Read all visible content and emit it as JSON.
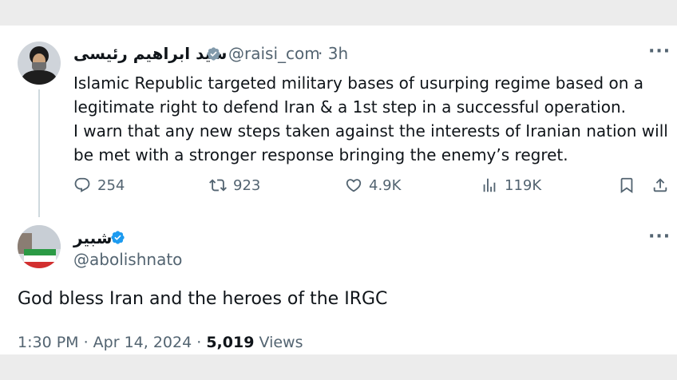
{
  "tweet": {
    "display_name": "سید ابراهیم رئیسی",
    "handle": "@raisi_com",
    "time": "· 3h",
    "more_label": "···",
    "lines": [
      "Islamic Republic targeted military bases of usurping regime based on a",
      "legitimate right to defend Iran & a 1st step in a successful operation.",
      "I warn that any new steps taken against the interests of Iranian nation will",
      "be met with a stronger response bringing the enemy’s regret."
    ],
    "actions": {
      "replies": "254",
      "reposts": "923",
      "likes": "4.9K",
      "views": "119K"
    },
    "icons": [
      "reply-icon",
      "repost-icon",
      "like-icon",
      "views-icon",
      "bookmark-icon",
      "share-icon"
    ]
  },
  "reply": {
    "display_name": "شبير",
    "handle": "@abolishnato",
    "more_label": "···",
    "text": "God bless Iran and the heroes of the IRGC",
    "timestamp": "1:30 PM · Apr 14, 2024 ·",
    "views_count": "5,019",
    "views_label": "Views"
  },
  "colors": {
    "verified": "#1d9bf0",
    "muted": "#536471",
    "text": "#0f1419"
  }
}
